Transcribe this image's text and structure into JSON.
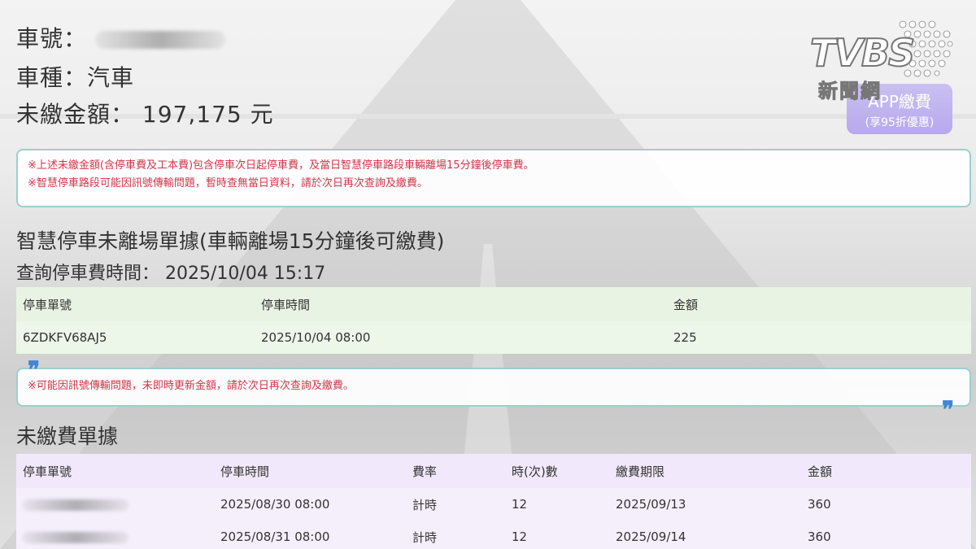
{
  "vehicle": {
    "plate_label": "車號：",
    "type_label": "車種：",
    "type_value": "汽車",
    "amount_label": "未繳金額：",
    "amount_value": "197,175 元"
  },
  "notice_top": {
    "line1": "※上述未繳金額(含停車費及工本費)包含停車次日起停車費，及當日智慧停車路段車輛離場15分鐘後停車費。",
    "line2": "※智慧停車路段可能因訊號傳輸問題，暫時查無當日資料，請於次日再次查詢及繳費。"
  },
  "smart_section": {
    "title": "智慧停車未離場單據(車輛離場15分鐘後可繳費)",
    "query_label": "查詢停車費時間：",
    "query_time": "2025/10/04 15:17",
    "headers": [
      "停車單號",
      "停車時間",
      "金額"
    ],
    "rows": [
      [
        "6ZDKFV68AJ5",
        "2025/10/04 08:00",
        "225"
      ]
    ]
  },
  "notice_mid": {
    "line1": "※可能因訊號傳輸問題，未即時更新金額，請於次日再次查詢及繳費。"
  },
  "unpaid_section": {
    "title": "未繳費單據",
    "headers": [
      "停車單號",
      "停車時間",
      "費率",
      "時(次)數",
      "繳費期限",
      "金額"
    ],
    "rows": [
      [
        "",
        "2025/08/30 08:00",
        "計時",
        "12",
        "2025/09/13",
        "360"
      ],
      [
        "",
        "2025/08/31 08:00",
        "計時",
        "12",
        "2025/09/14",
        "360"
      ]
    ]
  },
  "app_button": {
    "line1": "APP繳費",
    "line2": "(享95折優惠)"
  },
  "logo": {
    "brand": "TVBS",
    "subtitle": "新聞網"
  },
  "colors": {
    "notice_text": "#d3344a",
    "notice_border": "#9ecfcb",
    "smart_header_bg": "#e8f3e4",
    "smart_row_bg": "#ecf6e9",
    "unpaid_header_bg": "#f1e9fb",
    "unpaid_row_bg": "#f5effc",
    "quote_blue": "#3f86d6"
  }
}
